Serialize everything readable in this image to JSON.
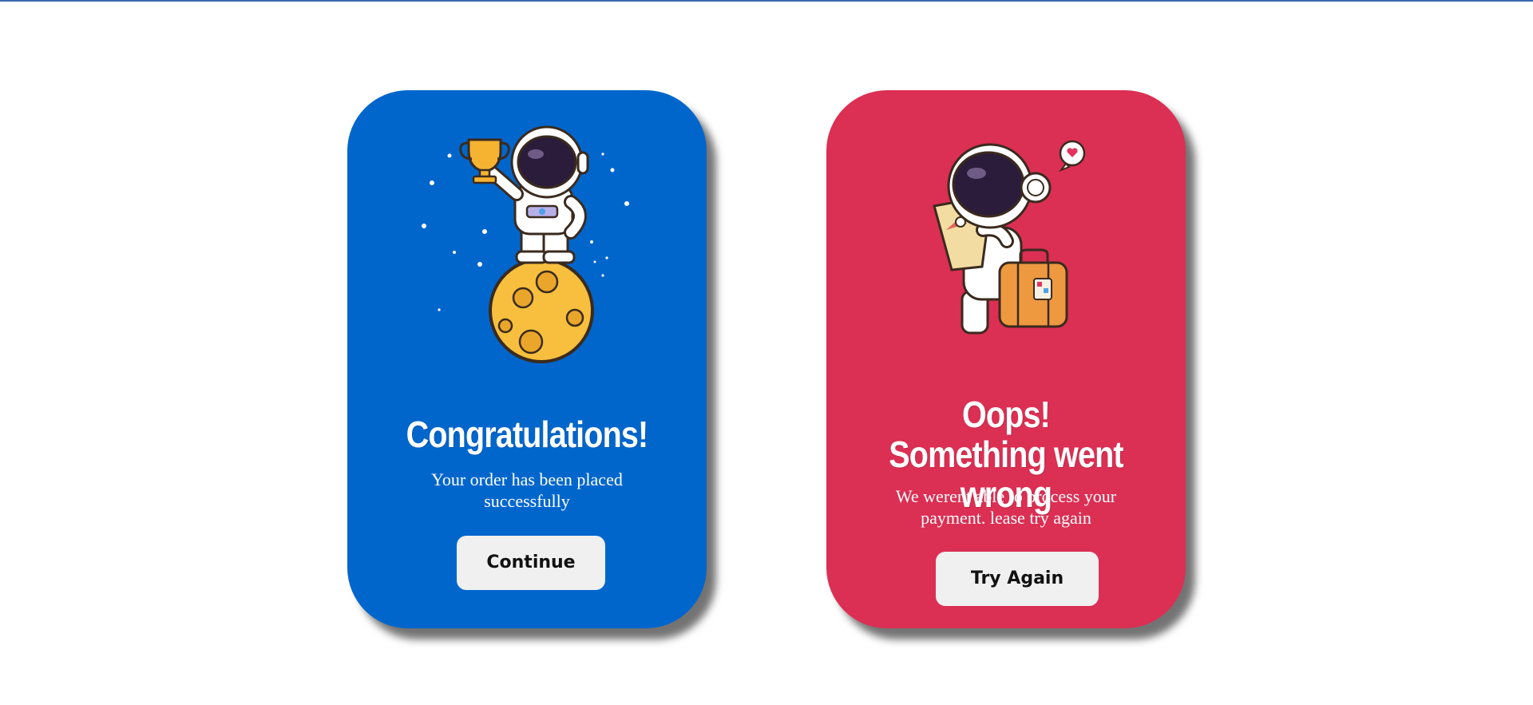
{
  "cards": [
    {
      "title": "Congratulations!",
      "message": "Your order has been placed successfully",
      "button_label": "Continue",
      "background": "#0066cc"
    },
    {
      "title_line1": "Oops!",
      "title_line2": "Something went wrong",
      "message": "We werent able to process your payment. lease try again",
      "button_label": "Try Again",
      "background": "#db2f53"
    }
  ],
  "icons": {
    "success_illustration": "astronaut-trophy-on-moon-illustration",
    "error_illustration": "astronaut-map-suitcase-illustration"
  }
}
